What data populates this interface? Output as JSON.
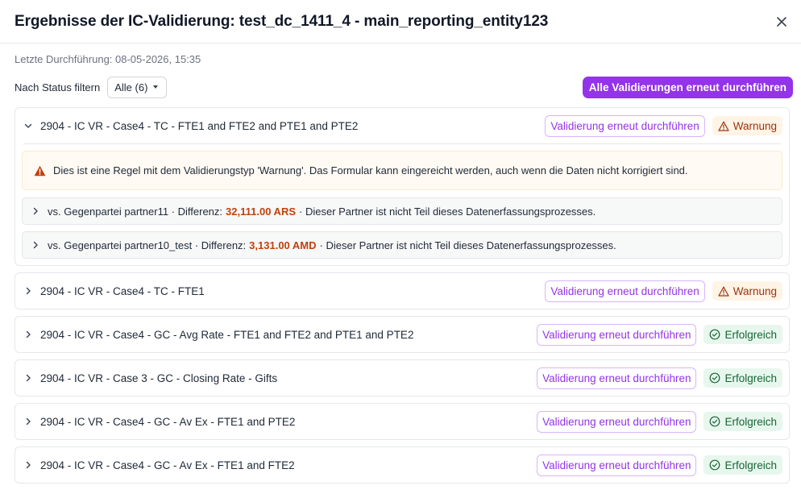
{
  "dialog": {
    "title": "Ergebnisse der IC-Validierung: test_dc_1411_4 - main_reporting_entity123",
    "last_run": "Letzte Durchführung: 08-05-2026, 15:35"
  },
  "filter": {
    "label": "Nach Status filtern",
    "selected": "Alle (6)"
  },
  "actions": {
    "rerun_all": "Alle Validierungen erneut durchführen",
    "rerun": "Validierung erneut durchführen"
  },
  "status": {
    "warning": "Warnung",
    "success": "Erfolgreich"
  },
  "colors": {
    "accent": "#9333ea",
    "warning": "#d97706",
    "success": "#16a34a",
    "amount": "#c2410c"
  },
  "validations": [
    {
      "title": "2904 - IC VR - Case4 - TC - FTE1 and FTE2 and PTE1 and PTE2",
      "expanded": true,
      "status": "Warnung",
      "message": "Dies ist eine Regel mit dem Validierungstyp 'Warnung'. Das Formular kann eingereicht werden, auch wenn die Daten nicht korrigiert sind.",
      "partners": [
        {
          "prefix": "vs. Gegenpartei partner11 · Differenz:",
          "amount": "32,111.00 ARS",
          "suffix": "· Dieser Partner ist nicht Teil dieses Datenerfassungsprozesses."
        },
        {
          "prefix": "vs. Gegenpartei partner10_test · Differenz:",
          "amount": "3,131.00 AMD",
          "suffix": "· Dieser Partner ist nicht Teil dieses Datenerfassungsprozesses."
        }
      ]
    },
    {
      "title": "2904 - IC VR - Case4 - TC - FTE1",
      "expanded": false,
      "status": "Warnung"
    },
    {
      "title": "2904 - IC VR - Case4 - GC - Avg Rate - FTE1 and FTE2 and PTE1 and PTE2",
      "expanded": false,
      "status": "Erfolgreich"
    },
    {
      "title": "2904 - IC VR - Case 3 - GC - Closing Rate - Gifts",
      "expanded": false,
      "status": "Erfolgreich"
    },
    {
      "title": "2904 - IC VR - Case4 - GC - Av Ex - FTE1 and PTE2",
      "expanded": false,
      "status": "Erfolgreich"
    },
    {
      "title": "2904 - IC VR - Case4 - GC - Av Ex - FTE1 and FTE2",
      "expanded": false,
      "status": "Erfolgreich"
    }
  ]
}
